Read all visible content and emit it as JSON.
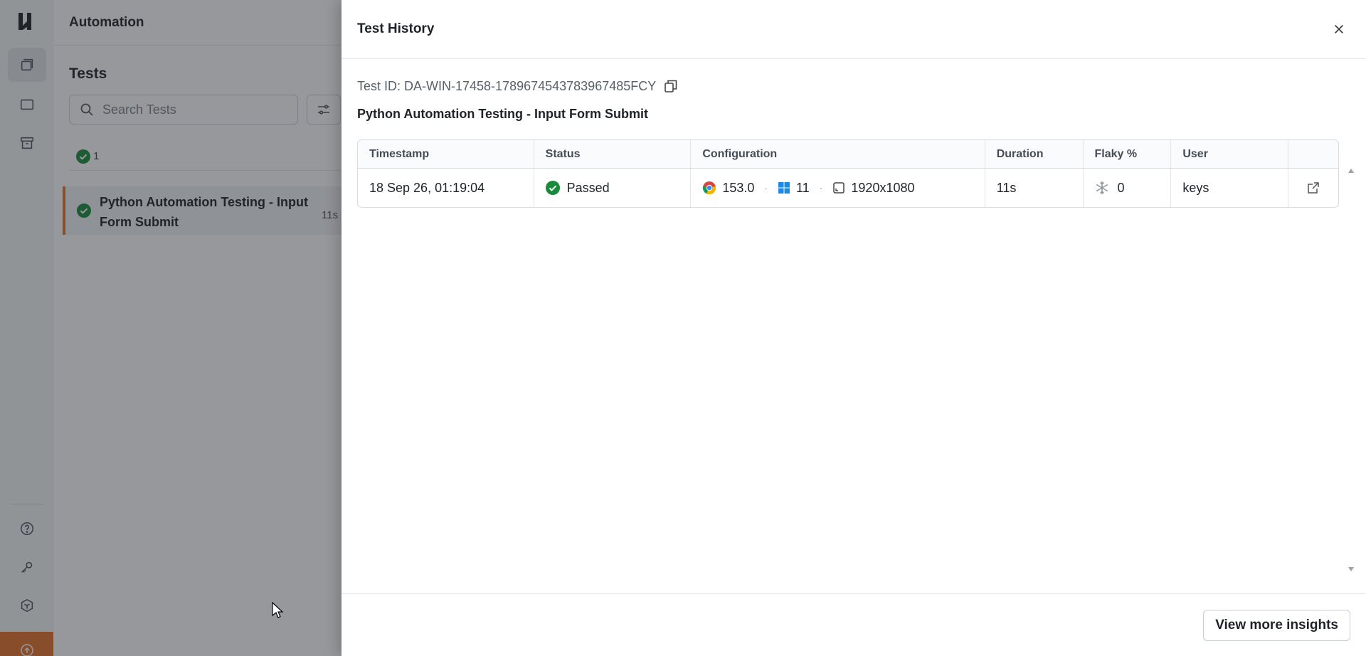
{
  "main": {
    "topbar_title": "Automation",
    "tests_title": "Tests",
    "search_placeholder": "Search Tests",
    "summary_count": "1",
    "test_item": {
      "name": "Python Automation Testing - Input Form Submit",
      "duration": "11s"
    }
  },
  "drawer": {
    "title": "Test History",
    "test_id": "Test ID: DA-WIN-17458-1789674543783967485FCY",
    "test_name": "Python Automation Testing - Input Form Submit",
    "table": {
      "headers": [
        "Timestamp",
        "Status",
        "Configuration",
        "Duration",
        "Flaky %",
        "User"
      ],
      "rows": [
        {
          "timestamp": "18 Sep 26, 01:19:04",
          "status": "Passed",
          "browser_version": "153.0",
          "os_version": "11",
          "resolution": "1920x1080",
          "duration": "11s",
          "flaky": "0",
          "user": "keys"
        }
      ]
    },
    "insights_button": "View more insights"
  },
  "colors": {
    "accent": "#e4712a",
    "pass": "#1a8a3a",
    "overlay": "rgba(35,40,46,0.48)"
  },
  "icons": {
    "rail": [
      "logo-icon",
      "builds-icon",
      "dashboard-icon",
      "archive-icon",
      "help-icon",
      "key-icon",
      "integrations-icon",
      "upgrade-icon"
    ],
    "drawer": [
      "close-icon",
      "copy-icon",
      "check-circle-icon",
      "chrome-icon",
      "windows-icon",
      "resolution-icon",
      "snowflake-icon",
      "external-link-icon"
    ]
  }
}
